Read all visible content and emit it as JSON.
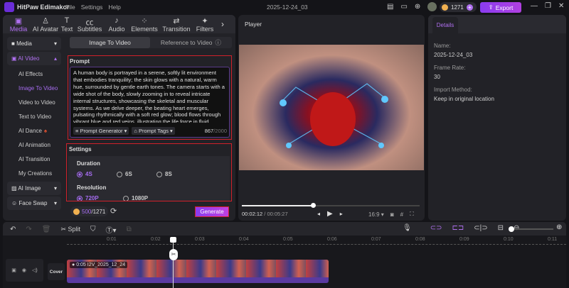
{
  "app": {
    "title": "HitPaw Edimakor",
    "menu": [
      "File",
      "Settings",
      "Help"
    ],
    "project": "2025-12-24_03",
    "credits": "1271",
    "export": "Export"
  },
  "toolbar_tabs": [
    {
      "label": "Media",
      "icon": "▣"
    },
    {
      "label": "AI Avatar",
      "icon": "♙"
    },
    {
      "label": "Text",
      "icon": "T"
    },
    {
      "label": "Subtitles",
      "icon": "㏄"
    },
    {
      "label": "Audio",
      "icon": "♪"
    },
    {
      "label": "Elements",
      "icon": "⁘"
    },
    {
      "label": "Transition",
      "icon": "⇄"
    },
    {
      "label": "Filters",
      "icon": "✦"
    }
  ],
  "sidebar": {
    "groups": {
      "media": "Media",
      "ai_video": "AI Video",
      "ai_image": "AI Image",
      "face_swap": "Face Swap"
    },
    "items": [
      "AI Effects",
      "Image To Video",
      "Video to Video",
      "Text to Video",
      "AI Dance",
      "AI Animation",
      "AI Transition",
      "My Creations"
    ]
  },
  "subtabs": {
    "active": "Image To Video",
    "other": "Reference to Video"
  },
  "prompt": {
    "heading": "Prompt",
    "text": "A human body is portrayed in a serene, softly lit environment that embodies tranquility; the skin glows with a natural, warm hue, surrounded by gentle earth tones. The camera starts with a wide shot of the body, slowly zooming in to reveal intricate internal structures, showcasing the skeletal and muscular systems. As we delve deeper, the beating heart emerges, pulsating rhythmically with a soft red glow; blood flows through vibrant blue and red veins, illustrating the life force in fluid",
    "generator": "Prompt Generator",
    "tags": "Prompt Tags",
    "count": "867",
    "max": "/2000"
  },
  "settings": {
    "heading": "Settings",
    "duration_label": "Duration",
    "durations": [
      "4S",
      "6S",
      "8S"
    ],
    "resolution_label": "Resolution",
    "resolutions": [
      "720P",
      "1080P"
    ]
  },
  "cost": {
    "used": "500",
    "total": "/1271"
  },
  "generate": "Generate",
  "player": {
    "title": "Player",
    "current": "00:02:12",
    "total": " / 00:05:27",
    "aspect": "16:9",
    "progress": 0.4
  },
  "details": {
    "tab": "Details",
    "name_label": "Name:",
    "name": "2025-12-24_03",
    "fps_label": "Frame Rate:",
    "fps": "30",
    "import_label": "Import Method:",
    "import": "Keep in original location"
  },
  "timeline": {
    "split": "Split",
    "ruler": [
      "0:01",
      "0:02",
      "0:03",
      "0:04",
      "0:05",
      "0:06",
      "0:07",
      "0:08",
      "0:09",
      "0:10",
      "0:11"
    ],
    "cover": "Cover",
    "clip": "0:05 I2V_2025_12_24"
  }
}
